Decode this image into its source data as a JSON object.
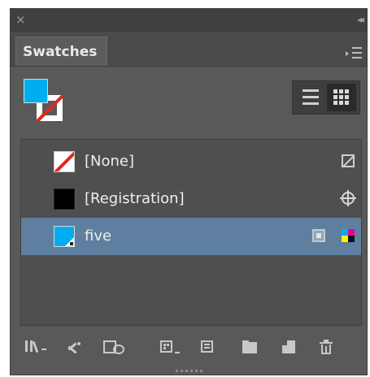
{
  "window": {
    "close_glyph": "×",
    "collapse_glyph": "◂◂"
  },
  "panel": {
    "tab_label": "Swatches"
  },
  "colors": {
    "accent_fill": "#00aeef",
    "none_slash": "#e0281e",
    "selected_row": "#5e7f9f"
  },
  "swatches": [
    {
      "label": "[None]",
      "chip": "none",
      "right_icon": "no-edit-icon"
    },
    {
      "label": "[Registration]",
      "chip": "registration",
      "right_icon": "registration-icon"
    },
    {
      "label": "five",
      "chip": "cyan",
      "selected": true,
      "right_icons": [
        "process-color-icon",
        "cmyk-icon"
      ]
    }
  ],
  "toolbar": {
    "icons": [
      "show-all-swatches-icon",
      "show-color-swatches-icon",
      "show-gradient-swatches-icon",
      "swatch-views-icon",
      "new-color-group-icon",
      "new-swatch-folder-icon",
      "new-swatch-icon",
      "delete-swatch-icon"
    ]
  }
}
